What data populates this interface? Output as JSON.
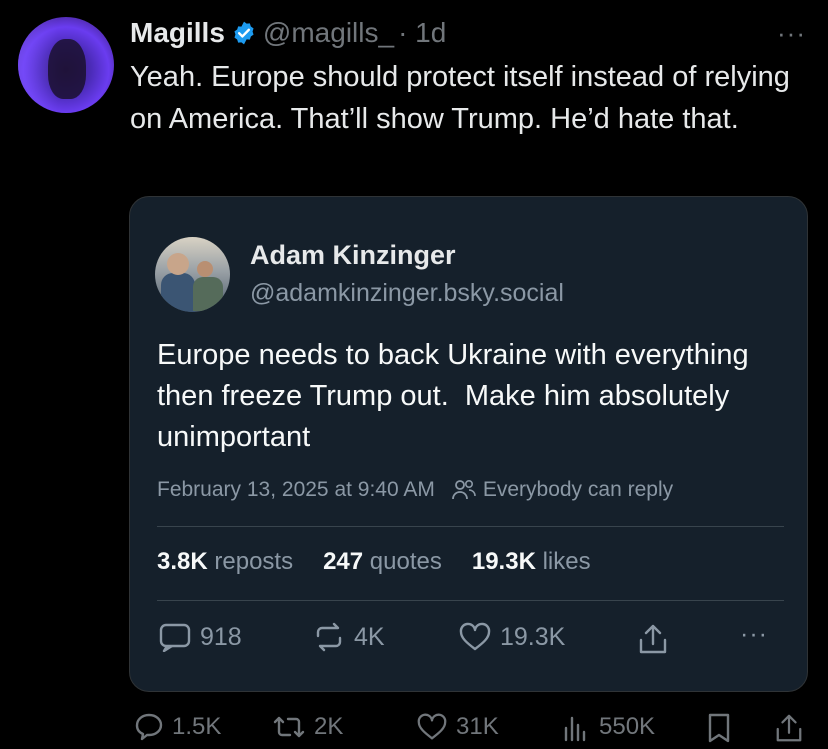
{
  "tweet": {
    "author_name": "Magills",
    "author_handle": "@magills_",
    "time": "· 1d",
    "more": "···",
    "text": "Yeah. Europe should protect itself instead of relying on America. That’ll show Trump. He’d hate that."
  },
  "quote": {
    "author_name": "Adam Kinzinger",
    "author_handle": "@adamkinzinger.bsky.social",
    "text": "Europe needs to back Ukraine with everything then freeze Trump out.  Make him absolutely unimportant",
    "timestamp": "February 13, 2025 at 9:40 AM",
    "reply_setting": "Everybody can reply",
    "stats": {
      "reposts_value": "3.8K",
      "reposts_label": "reposts",
      "quotes_value": "247",
      "quotes_label": "quotes",
      "likes_value": "19.3K",
      "likes_label": "likes"
    },
    "actions": {
      "reply_count": "918",
      "repost_count": "4K",
      "like_count": "19.3K",
      "more": "···"
    }
  },
  "actions": {
    "reply_count": "1.5K",
    "repost_count": "2K",
    "like_count": "31K",
    "view_count": "550K"
  },
  "colors": {
    "background": "#000000",
    "card_background": "#15202b",
    "verified": "#1d9bf0",
    "secondary_text": "#71767b"
  }
}
